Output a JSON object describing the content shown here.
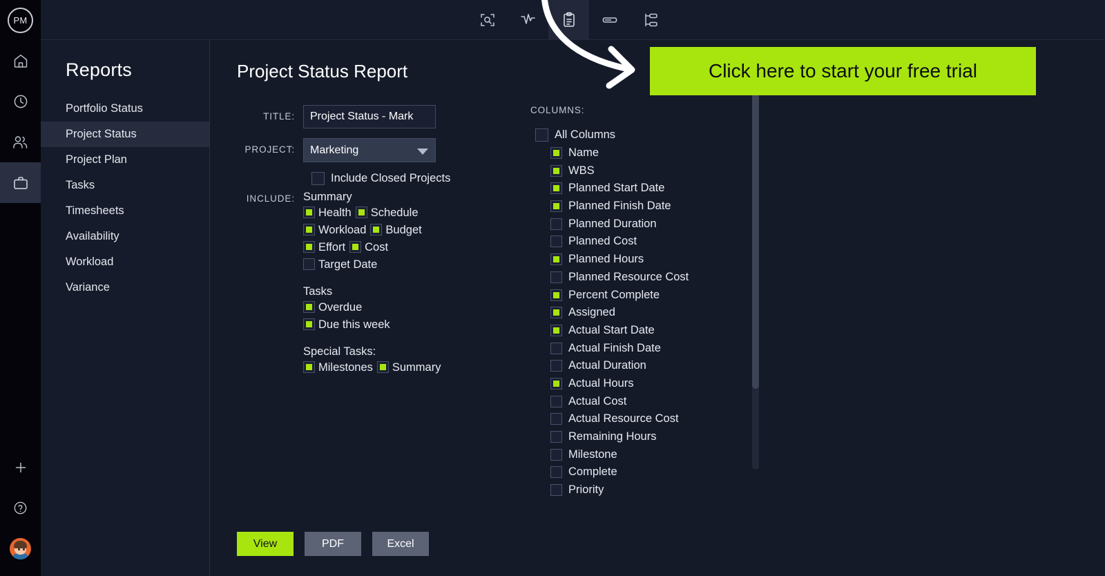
{
  "brand": {
    "logo_text": "PM"
  },
  "topbar": {
    "icons": [
      {
        "name": "scan-search-icon",
        "label": "Scan Search"
      },
      {
        "name": "activity-pulse-icon",
        "label": "Activity"
      },
      {
        "name": "clipboard-icon",
        "label": "Reports",
        "active": true
      },
      {
        "name": "bar-icon",
        "label": "Bar"
      },
      {
        "name": "hierarchy-icon",
        "label": "Hierarchy"
      }
    ]
  },
  "rail": {
    "items": [
      {
        "name": "home-icon",
        "label": "Home"
      },
      {
        "name": "clock-icon",
        "label": "Time"
      },
      {
        "name": "people-icon",
        "label": "Team"
      },
      {
        "name": "briefcase-icon",
        "label": "Projects",
        "active": true
      }
    ],
    "bottom": [
      {
        "name": "plus-icon",
        "label": "Add"
      },
      {
        "name": "help-icon",
        "label": "Help"
      },
      {
        "name": "avatar",
        "label": "Account"
      }
    ]
  },
  "sidebar": {
    "title": "Reports",
    "items": [
      {
        "label": "Portfolio Status",
        "active": false
      },
      {
        "label": "Project Status",
        "active": true
      },
      {
        "label": "Project Plan",
        "active": false
      },
      {
        "label": "Tasks",
        "active": false
      },
      {
        "label": "Timesheets",
        "active": false
      },
      {
        "label": "Availability",
        "active": false
      },
      {
        "label": "Workload",
        "active": false
      },
      {
        "label": "Variance",
        "active": false
      }
    ]
  },
  "main": {
    "page_title": "Project Status Report",
    "form": {
      "title_label": "TITLE:",
      "title_value": "Project Status - Mark",
      "project_label": "PROJECT:",
      "project_value": "Marketing",
      "include_closed_label": "Include Closed Projects",
      "include_closed_checked": false,
      "include_label": "INCLUDE:",
      "groups": [
        {
          "title": "Summary",
          "options": [
            {
              "label": "Health",
              "checked": true
            },
            {
              "label": "Schedule",
              "checked": true
            },
            {
              "label": "Workload",
              "checked": true
            },
            {
              "label": "Budget",
              "checked": true
            },
            {
              "label": "Effort",
              "checked": true
            },
            {
              "label": "Cost",
              "checked": true
            },
            {
              "label": "Target Date",
              "checked": false
            }
          ]
        },
        {
          "title": "Tasks",
          "options": [
            {
              "label": "Overdue",
              "checked": true
            },
            {
              "label": "Due this week",
              "checked": true
            }
          ]
        },
        {
          "title": "Special Tasks:",
          "options": [
            {
              "label": "Milestones",
              "checked": true
            },
            {
              "label": "Summary",
              "checked": true
            }
          ]
        }
      ]
    },
    "buttons": [
      {
        "label": "View",
        "style": "primary"
      },
      {
        "label": "PDF",
        "style": "secondary"
      },
      {
        "label": "Excel",
        "style": "secondary"
      }
    ],
    "columns": {
      "header": "COLUMNS:",
      "root": {
        "label": "All Columns",
        "checked": false
      },
      "items": [
        {
          "label": "Name",
          "checked": true
        },
        {
          "label": "WBS",
          "checked": true
        },
        {
          "label": "Planned Start Date",
          "checked": true
        },
        {
          "label": "Planned Finish Date",
          "checked": true
        },
        {
          "label": "Planned Duration",
          "checked": false
        },
        {
          "label": "Planned Cost",
          "checked": false
        },
        {
          "label": "Planned Hours",
          "checked": true
        },
        {
          "label": "Planned Resource Cost",
          "checked": false
        },
        {
          "label": "Percent Complete",
          "checked": true
        },
        {
          "label": "Assigned",
          "checked": true
        },
        {
          "label": "Actual Start Date",
          "checked": true
        },
        {
          "label": "Actual Finish Date",
          "checked": false
        },
        {
          "label": "Actual Duration",
          "checked": false
        },
        {
          "label": "Actual Hours",
          "checked": true
        },
        {
          "label": "Actual Cost",
          "checked": false
        },
        {
          "label": "Actual Resource Cost",
          "checked": false
        },
        {
          "label": "Remaining Hours",
          "checked": false
        },
        {
          "label": "Milestone",
          "checked": false
        },
        {
          "label": "Complete",
          "checked": false
        },
        {
          "label": "Priority",
          "checked": false
        }
      ]
    }
  },
  "cta": {
    "text": "Click here to start your free trial",
    "bg_color": "#a8e50f",
    "text_color": "#0c0d12"
  },
  "colors": {
    "accent_green": "#a8e50f",
    "app_bg": "#151a29",
    "panel_bg": "#161b2b",
    "rail_bg": "#04040a"
  }
}
